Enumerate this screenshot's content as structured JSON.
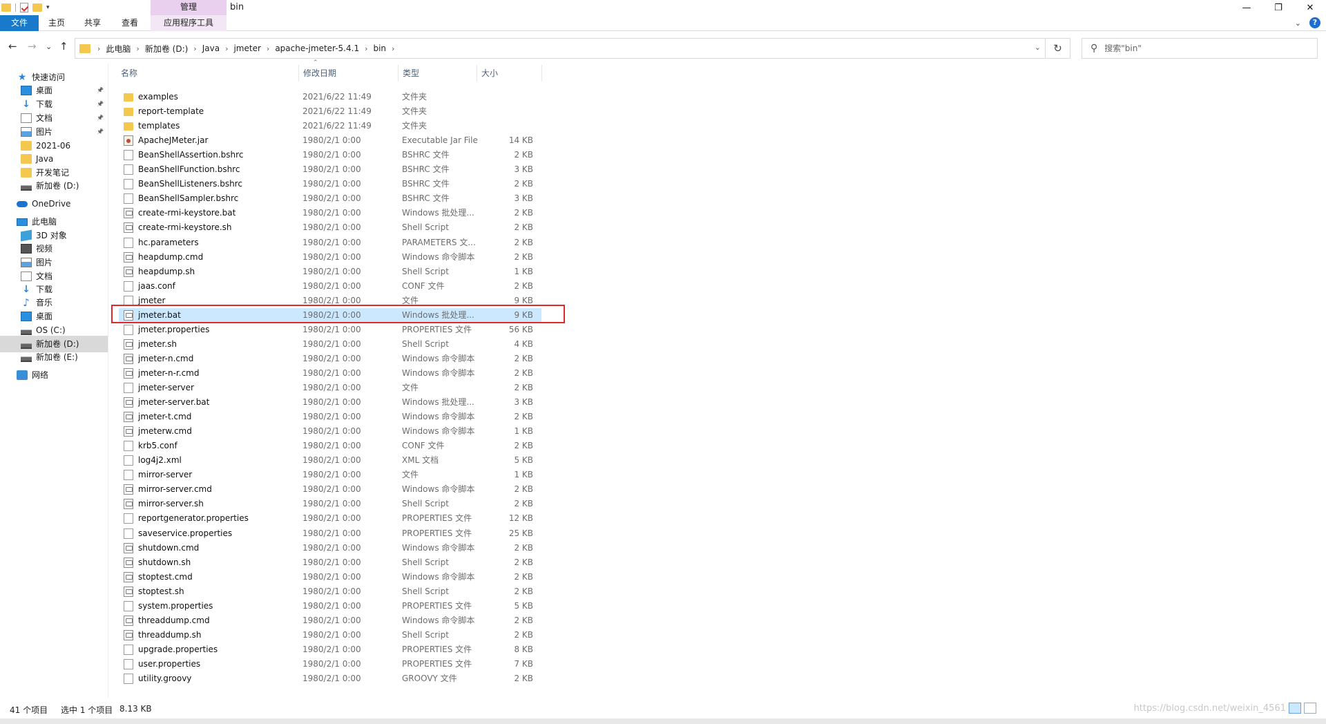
{
  "window": {
    "title": "bin",
    "manage_tab": "管理",
    "minimize": "—",
    "restore": "❐",
    "close": "✕"
  },
  "ribbon": {
    "tabs": [
      "文件",
      "主页",
      "共享",
      "查看",
      "应用程序工具"
    ]
  },
  "nav": {
    "back": "←",
    "forward": "→",
    "recent": "⌄",
    "up": "↑",
    "refresh": "↻",
    "breadcrumb": [
      "此电脑",
      "新加卷 (D:)",
      "Java",
      "jmeter",
      "apache-jmeter-5.4.1",
      "bin"
    ],
    "search_placeholder": "搜索\"bin\""
  },
  "sidebar": {
    "items": [
      {
        "label": "快速访问",
        "icon": "star-icon",
        "pinned": false
      },
      {
        "label": "桌面",
        "icon": "desktop-icon",
        "pinned": true
      },
      {
        "label": "下载",
        "icon": "download-icon",
        "pinned": true
      },
      {
        "label": "文档",
        "icon": "document-icon",
        "pinned": true
      },
      {
        "label": "图片",
        "icon": "pictures-icon",
        "pinned": true
      },
      {
        "label": "2021-06",
        "icon": "folder-icon",
        "pinned": false
      },
      {
        "label": "Java",
        "icon": "folder-icon",
        "pinned": false
      },
      {
        "label": "开发笔记",
        "icon": "folder-icon",
        "pinned": false
      },
      {
        "label": "新加卷 (D:)",
        "icon": "drive-icon",
        "pinned": false
      },
      {
        "label": "OneDrive",
        "icon": "cloud-icon",
        "pinned": false
      },
      {
        "label": "此电脑",
        "icon": "computer-icon",
        "pinned": false
      },
      {
        "label": "3D 对象",
        "icon": "3d-objects-icon",
        "pinned": false
      },
      {
        "label": "视频",
        "icon": "video-icon",
        "pinned": false
      },
      {
        "label": "图片",
        "icon": "pictures-icon",
        "pinned": false
      },
      {
        "label": "文档",
        "icon": "document-icon",
        "pinned": false
      },
      {
        "label": "下载",
        "icon": "download-icon",
        "pinned": false
      },
      {
        "label": "音乐",
        "icon": "music-icon",
        "pinned": false
      },
      {
        "label": "桌面",
        "icon": "desktop-icon",
        "pinned": false
      },
      {
        "label": "OS (C:)",
        "icon": "os-drive-icon",
        "pinned": false
      },
      {
        "label": "新加卷 (D:)",
        "icon": "drive-icon",
        "pinned": false,
        "selected": true
      },
      {
        "label": "新加卷 (E:)",
        "icon": "drive-icon",
        "pinned": false
      },
      {
        "label": "网络",
        "icon": "network-icon",
        "pinned": false
      }
    ]
  },
  "columns": {
    "name": "名称",
    "date": "修改日期",
    "type": "类型",
    "size": "大小"
  },
  "files": [
    {
      "name": "examples",
      "date": "2021/6/22 11:49",
      "type": "文件夹",
      "size": "",
      "icon": "folder"
    },
    {
      "name": "report-template",
      "date": "2021/6/22 11:49",
      "type": "文件夹",
      "size": "",
      "icon": "folder"
    },
    {
      "name": "templates",
      "date": "2021/6/22 11:49",
      "type": "文件夹",
      "size": "",
      "icon": "folder"
    },
    {
      "name": "ApacheJMeter.jar",
      "date": "1980/2/1 0:00",
      "type": "Executable Jar File",
      "size": "14 KB",
      "icon": "jar"
    },
    {
      "name": "BeanShellAssertion.bshrc",
      "date": "1980/2/1 0:00",
      "type": "BSHRC 文件",
      "size": "2 KB",
      "icon": "file"
    },
    {
      "name": "BeanShellFunction.bshrc",
      "date": "1980/2/1 0:00",
      "type": "BSHRC 文件",
      "size": "3 KB",
      "icon": "file"
    },
    {
      "name": "BeanShellListeners.bshrc",
      "date": "1980/2/1 0:00",
      "type": "BSHRC 文件",
      "size": "2 KB",
      "icon": "file"
    },
    {
      "name": "BeanShellSampler.bshrc",
      "date": "1980/2/1 0:00",
      "type": "BSHRC 文件",
      "size": "3 KB",
      "icon": "file"
    },
    {
      "name": "create-rmi-keystore.bat",
      "date": "1980/2/1 0:00",
      "type": "Windows 批处理...",
      "size": "2 KB",
      "icon": "script"
    },
    {
      "name": "create-rmi-keystore.sh",
      "date": "1980/2/1 0:00",
      "type": "Shell Script",
      "size": "2 KB",
      "icon": "script"
    },
    {
      "name": "hc.parameters",
      "date": "1980/2/1 0:00",
      "type": "PARAMETERS 文...",
      "size": "2 KB",
      "icon": "file"
    },
    {
      "name": "heapdump.cmd",
      "date": "1980/2/1 0:00",
      "type": "Windows 命令脚本",
      "size": "2 KB",
      "icon": "script"
    },
    {
      "name": "heapdump.sh",
      "date": "1980/2/1 0:00",
      "type": "Shell Script",
      "size": "1 KB",
      "icon": "script"
    },
    {
      "name": "jaas.conf",
      "date": "1980/2/1 0:00",
      "type": "CONF 文件",
      "size": "2 KB",
      "icon": "file"
    },
    {
      "name": "jmeter",
      "date": "1980/2/1 0:00",
      "type": "文件",
      "size": "9 KB",
      "icon": "file"
    },
    {
      "name": "jmeter.bat",
      "date": "1980/2/1 0:00",
      "type": "Windows 批处理...",
      "size": "9 KB",
      "icon": "script",
      "selected": true
    },
    {
      "name": "jmeter.properties",
      "date": "1980/2/1 0:00",
      "type": "PROPERTIES 文件",
      "size": "56 KB",
      "icon": "file"
    },
    {
      "name": "jmeter.sh",
      "date": "1980/2/1 0:00",
      "type": "Shell Script",
      "size": "4 KB",
      "icon": "script"
    },
    {
      "name": "jmeter-n.cmd",
      "date": "1980/2/1 0:00",
      "type": "Windows 命令脚本",
      "size": "2 KB",
      "icon": "script"
    },
    {
      "name": "jmeter-n-r.cmd",
      "date": "1980/2/1 0:00",
      "type": "Windows 命令脚本",
      "size": "2 KB",
      "icon": "script"
    },
    {
      "name": "jmeter-server",
      "date": "1980/2/1 0:00",
      "type": "文件",
      "size": "2 KB",
      "icon": "file"
    },
    {
      "name": "jmeter-server.bat",
      "date": "1980/2/1 0:00",
      "type": "Windows 批处理...",
      "size": "3 KB",
      "icon": "script"
    },
    {
      "name": "jmeter-t.cmd",
      "date": "1980/2/1 0:00",
      "type": "Windows 命令脚本",
      "size": "2 KB",
      "icon": "script"
    },
    {
      "name": "jmeterw.cmd",
      "date": "1980/2/1 0:00",
      "type": "Windows 命令脚本",
      "size": "1 KB",
      "icon": "script"
    },
    {
      "name": "krb5.conf",
      "date": "1980/2/1 0:00",
      "type": "CONF 文件",
      "size": "2 KB",
      "icon": "file"
    },
    {
      "name": "log4j2.xml",
      "date": "1980/2/1 0:00",
      "type": "XML 文档",
      "size": "5 KB",
      "icon": "file"
    },
    {
      "name": "mirror-server",
      "date": "1980/2/1 0:00",
      "type": "文件",
      "size": "1 KB",
      "icon": "file"
    },
    {
      "name": "mirror-server.cmd",
      "date": "1980/2/1 0:00",
      "type": "Windows 命令脚本",
      "size": "2 KB",
      "icon": "script"
    },
    {
      "name": "mirror-server.sh",
      "date": "1980/2/1 0:00",
      "type": "Shell Script",
      "size": "2 KB",
      "icon": "script"
    },
    {
      "name": "reportgenerator.properties",
      "date": "1980/2/1 0:00",
      "type": "PROPERTIES 文件",
      "size": "12 KB",
      "icon": "file"
    },
    {
      "name": "saveservice.properties",
      "date": "1980/2/1 0:00",
      "type": "PROPERTIES 文件",
      "size": "25 KB",
      "icon": "file"
    },
    {
      "name": "shutdown.cmd",
      "date": "1980/2/1 0:00",
      "type": "Windows 命令脚本",
      "size": "2 KB",
      "icon": "script"
    },
    {
      "name": "shutdown.sh",
      "date": "1980/2/1 0:00",
      "type": "Shell Script",
      "size": "2 KB",
      "icon": "script"
    },
    {
      "name": "stoptest.cmd",
      "date": "1980/2/1 0:00",
      "type": "Windows 命令脚本",
      "size": "2 KB",
      "icon": "script"
    },
    {
      "name": "stoptest.sh",
      "date": "1980/2/1 0:00",
      "type": "Shell Script",
      "size": "2 KB",
      "icon": "script"
    },
    {
      "name": "system.properties",
      "date": "1980/2/1 0:00",
      "type": "PROPERTIES 文件",
      "size": "5 KB",
      "icon": "file"
    },
    {
      "name": "threaddump.cmd",
      "date": "1980/2/1 0:00",
      "type": "Windows 命令脚本",
      "size": "2 KB",
      "icon": "script"
    },
    {
      "name": "threaddump.sh",
      "date": "1980/2/1 0:00",
      "type": "Shell Script",
      "size": "2 KB",
      "icon": "script"
    },
    {
      "name": "upgrade.properties",
      "date": "1980/2/1 0:00",
      "type": "PROPERTIES 文件",
      "size": "8 KB",
      "icon": "file"
    },
    {
      "name": "user.properties",
      "date": "1980/2/1 0:00",
      "type": "PROPERTIES 文件",
      "size": "7 KB",
      "icon": "file"
    },
    {
      "name": "utility.groovy",
      "date": "1980/2/1 0:00",
      "type": "GROOVY 文件",
      "size": "2 KB",
      "icon": "file"
    }
  ],
  "status": {
    "count": "41 个项目",
    "selected": "选中 1 个项目",
    "size": "8.13 KB",
    "watermark": "https://blog.csdn.net/weixin_4561"
  },
  "colors": {
    "accent": "#1979ca",
    "selection": "#cce8ff",
    "highlight_border": "#e0292f",
    "folder": "#f4c84e"
  }
}
